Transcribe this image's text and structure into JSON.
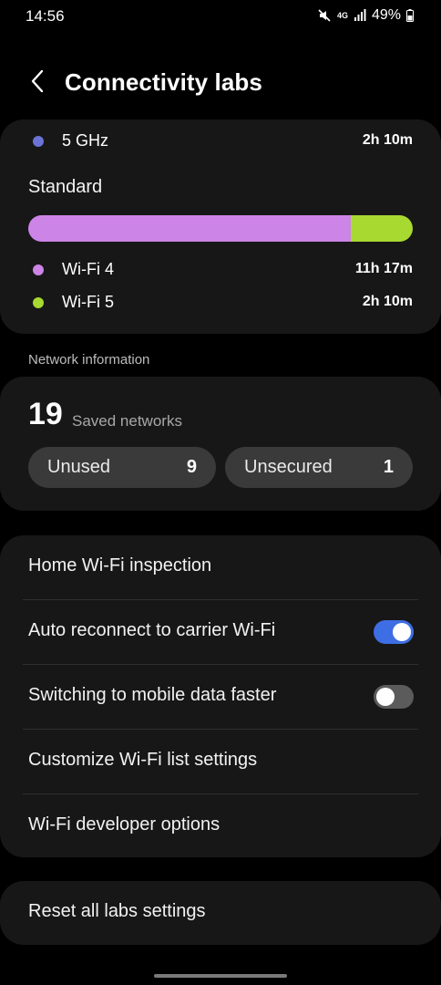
{
  "status_bar": {
    "time": "14:56",
    "network_type": "4G",
    "battery_percent": "49%",
    "icons": [
      "mute-icon",
      "signal-icon",
      "battery-icon"
    ]
  },
  "header": {
    "title": "Connectivity labs",
    "back_icon": "chevron-left-icon"
  },
  "frequency_card": {
    "top_legend": {
      "label": "5 GHz",
      "value": "2h 10m",
      "color": "#6b74d6"
    },
    "standard_title": "Standard",
    "usage_bar": [
      {
        "name": "Wi-Fi 4",
        "fraction": 0.839,
        "color": "#cc84e6"
      },
      {
        "name": "Wi-Fi 5",
        "fraction": 0.161,
        "color": "#a8d930"
      }
    ],
    "legend": [
      {
        "label": "Wi-Fi 4",
        "value": "11h 17m",
        "color": "#cc84e6"
      },
      {
        "label": "Wi-Fi 5",
        "value": "2h 10m",
        "color": "#a8d930"
      }
    ]
  },
  "network_info": {
    "section_title": "Network information",
    "saved_count": "19",
    "saved_caption": "Saved networks",
    "unused_label": "Unused",
    "unused_count": "9",
    "unsecured_label": "Unsecured",
    "unsecured_count": "1"
  },
  "settings": {
    "home_inspection": "Home Wi-Fi inspection",
    "auto_reconnect": {
      "label": "Auto reconnect to carrier Wi-Fi",
      "enabled": true
    },
    "switch_mobile": {
      "label": "Switching to mobile data faster",
      "enabled": false
    },
    "customize_list": "Customize Wi-Fi list settings",
    "developer_options": "Wi-Fi developer options"
  },
  "reset": {
    "label": "Reset all labs settings"
  },
  "colors": {
    "accent": "#3e6ee3",
    "card_background": "#171717",
    "pill_background": "#3a3a3a"
  }
}
